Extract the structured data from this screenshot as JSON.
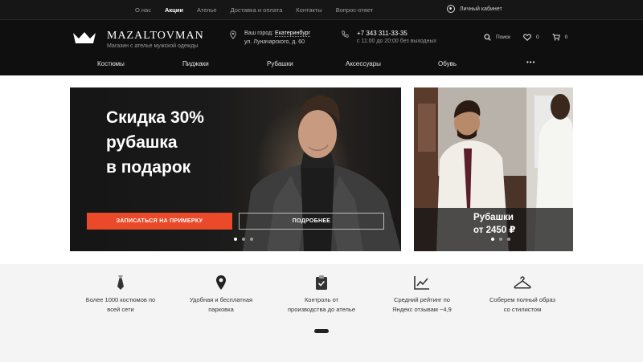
{
  "topnav": {
    "links": [
      "О нас",
      "Акции",
      "Ателье",
      "Доставка и оплата",
      "Контакты",
      "Вопрос-ответ"
    ],
    "active_index": 1,
    "cabinet": "Личный кабинет"
  },
  "brand": {
    "name": "MAZALTOVMAN",
    "tagline": "Магазин с ателье мужской одежды"
  },
  "location": {
    "label": "Ваш город:",
    "city": "Екатеринбург",
    "address": "ул. Луначарского, д. 60"
  },
  "contact": {
    "phone": "+7 343 311-33-35",
    "hours": "с 11:00 до 20:00 без выходных"
  },
  "tools": {
    "search": "Поиск",
    "favorites_count": "0",
    "cart_count": "0"
  },
  "catnav": {
    "items": [
      "Костюмы",
      "Пиджаки",
      "Рубашки",
      "Аксессуары",
      "Обувь"
    ],
    "more": "•••"
  },
  "hero": {
    "line1": "Скидка 30%",
    "line2": "рубашка",
    "line3": "в подарок",
    "primary_button": "ЗАПИСАТЬСЯ НА ПРИМЕРКУ",
    "secondary_button": "ПОДРОБНЕЕ",
    "slides": 3,
    "active_slide": 0
  },
  "side_promo": {
    "title": "Рубашки",
    "price": "от 2450 ₽",
    "slides": 3,
    "active_slide": 0
  },
  "features": [
    {
      "icon": "tie-icon",
      "text1": "Более 1000 костюмов по",
      "text2": "всей сети"
    },
    {
      "icon": "map-pin-icon",
      "text1": "Удобная и бесплатная",
      "text2": "парковка"
    },
    {
      "icon": "clipboard-check-icon",
      "text1": "Контроль от",
      "text2": "производства до ателье"
    },
    {
      "icon": "chart-icon",
      "text1": "Средний рейтинг по",
      "text2": "Яндекс отзывам ~4,9"
    },
    {
      "icon": "hanger-icon",
      "text1": "Соберем полный образ",
      "text2": "со стилистом"
    }
  ],
  "colors": {
    "topbar": "#161616",
    "header": "#0f0f0f",
    "accent": "#ea4a2a",
    "features_bg": "#f4f4f4"
  }
}
